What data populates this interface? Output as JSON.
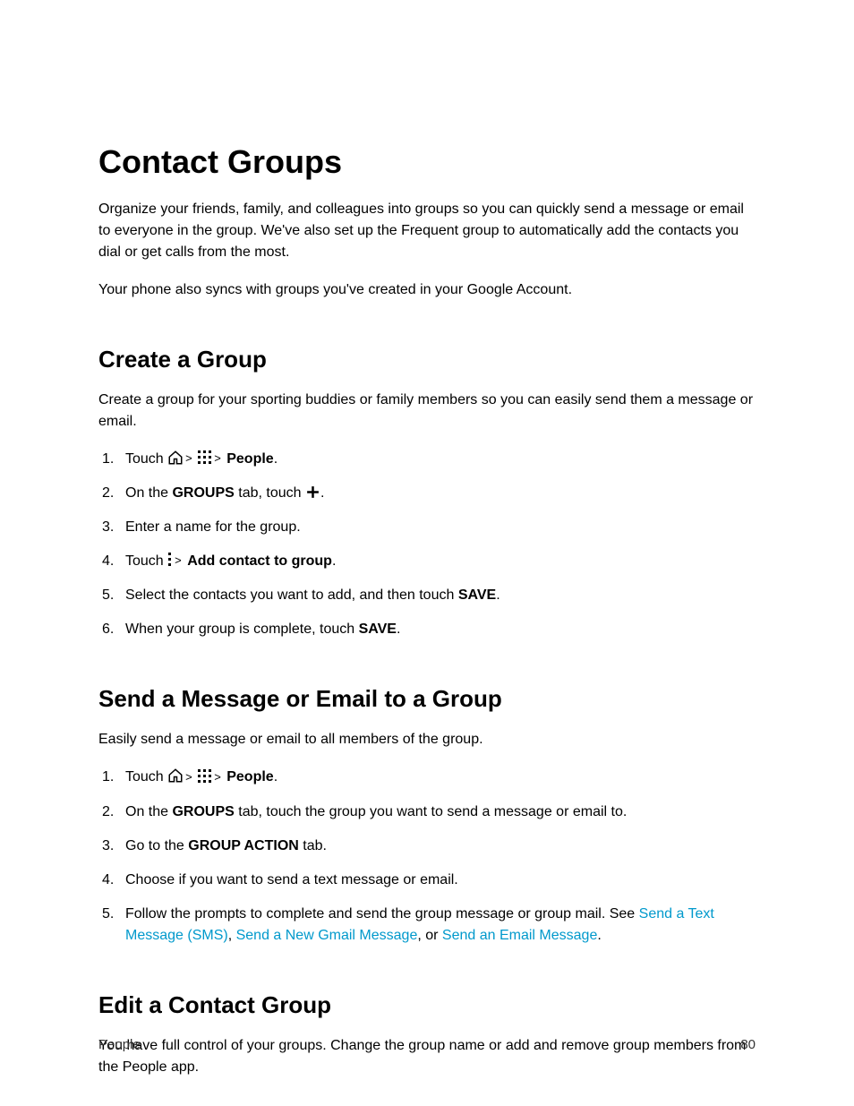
{
  "title": "Contact Groups",
  "intro_p1": "Organize your friends, family, and colleagues into groups so you can quickly send a message or email to everyone in the group. We've also set up the Frequent group to automatically add the contacts you dial or get calls from the most.",
  "intro_p2": "Your phone also syncs with groups you've created in your Google Account.",
  "section_create": {
    "heading": "Create a Group",
    "intro": "Create a group for your sporting buddies or family members so you can easily send them a message or email.",
    "step1_prefix": "Touch ",
    "step1_people": "People",
    "step2_prefix": "On the ",
    "step2_groups": "GROUPS",
    "step2_mid": " tab, touch ",
    "step3": "Enter a name for the group.",
    "step4_prefix": "Touch ",
    "step4_bold": "Add contact to group",
    "step5_prefix": "Select the contacts you want to add, and then touch ",
    "step5_bold": "SAVE",
    "step6_prefix": "When your group is complete, touch ",
    "step6_bold": "SAVE"
  },
  "section_send": {
    "heading": "Send a Message or Email to a Group",
    "intro": "Easily send a message or email to all members of the group.",
    "step1_prefix": "Touch ",
    "step1_people": "People",
    "step2_prefix": "On the ",
    "step2_groups": "GROUPS",
    "step2_suffix": " tab, touch the group you want to send a message or email to.",
    "step3_prefix": "Go to the ",
    "step3_bold": "GROUP ACTION",
    "step3_suffix": " tab.",
    "step4": "Choose if you want to send a text message or email.",
    "step5_prefix": "Follow the prompts to complete and send the group message or group mail. See ",
    "step5_link1": "Send a Text Message (SMS)",
    "step5_mid1": ", ",
    "step5_link2": "Send a New Gmail Message",
    "step5_mid2": ", or ",
    "step5_link3": "Send an Email Message",
    "step5_suffix": "."
  },
  "section_edit": {
    "heading": "Edit a Contact Group",
    "intro": "You have full control of your groups. Change the group name or add and remove group members from the People app."
  },
  "footer": {
    "section": "People",
    "page": "80"
  }
}
